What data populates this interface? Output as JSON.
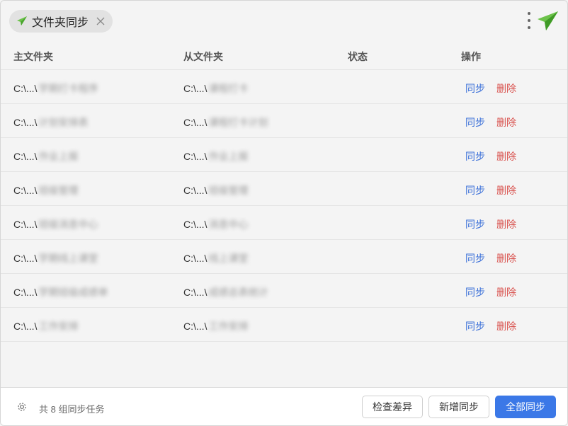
{
  "tab": {
    "label": "文件夹同步"
  },
  "columns": {
    "main": "主文件夹",
    "sub": "从文件夹",
    "status": "状态",
    "actions": "操作"
  },
  "row_actions": {
    "sync": "同步",
    "delete": "删除"
  },
  "rows": [
    {
      "main_prefix": "C:\\...\\",
      "main_rest": "学期打卡程序",
      "sub_prefix": "C:\\...\\",
      "sub_rest": "课程打卡",
      "status": ""
    },
    {
      "main_prefix": "C:\\...\\",
      "main_rest": "计划安排表",
      "sub_prefix": "C:\\...\\",
      "sub_rest": "课程打卡计划",
      "status": ""
    },
    {
      "main_prefix": "C:\\...\\",
      "main_rest": "作业上报",
      "sub_prefix": "C:\\...\\",
      "sub_rest": "作业上报",
      "status": ""
    },
    {
      "main_prefix": "C:\\...\\",
      "main_rest": "班级管理",
      "sub_prefix": "C:\\...\\",
      "sub_rest": "班级管理",
      "status": ""
    },
    {
      "main_prefix": "C:\\...\\",
      "main_rest": "班级消息中心",
      "sub_prefix": "C:\\...\\",
      "sub_rest": "消息中心",
      "status": ""
    },
    {
      "main_prefix": "C:\\...\\",
      "main_rest": "学期线上课堂",
      "sub_prefix": "C:\\...\\",
      "sub_rest": "线上课堂",
      "status": ""
    },
    {
      "main_prefix": "C:\\...\\",
      "main_rest": "学期班级成绩单",
      "sub_prefix": "C:\\...\\",
      "sub_rest": "成绩总表统计",
      "status": ""
    },
    {
      "main_prefix": "C:\\...\\",
      "main_rest": "工作安排",
      "sub_prefix": "C:\\...\\",
      "sub_rest": "工作安排",
      "status": ""
    }
  ],
  "footer": {
    "count_text": "共 8 组同步任务",
    "check_diff": "检查差异",
    "add_sync": "新增同步",
    "sync_all": "全部同步"
  },
  "icons": {
    "tab": "paper-plane-icon",
    "close": "close-icon",
    "more": "more-vertical-icon",
    "brand": "paper-plane-icon",
    "settings": "gear-icon"
  },
  "colors": {
    "accent": "#3b78e7",
    "link": "#3a6fd8",
    "danger": "#d9534f",
    "brand_green": "#5dbb3c"
  }
}
